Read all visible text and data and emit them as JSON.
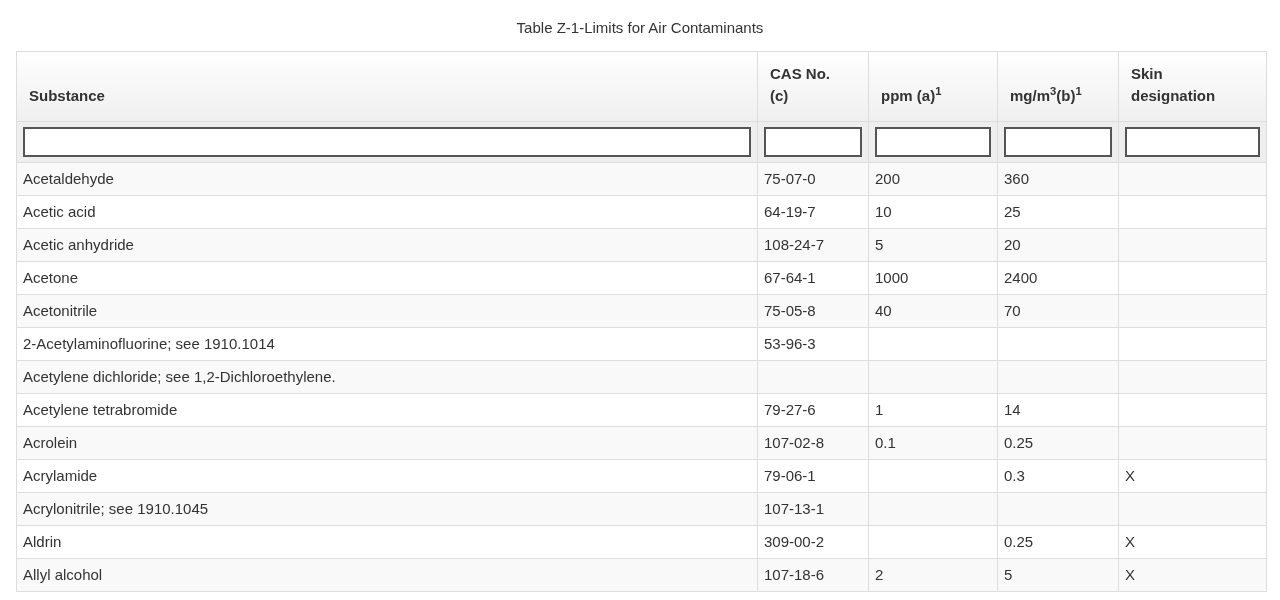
{
  "title": "Table Z-1-Limits for Air Contaminants",
  "table": {
    "columns": [
      {
        "label": "Substance"
      },
      {
        "label": "CAS No. (c)"
      },
      {
        "label": "ppm (a)$^{1}$"
      },
      {
        "label": "mg/m$^{3}$(b)$^{1}$"
      },
      {
        "label": "Skin designation"
      }
    ],
    "rows": [
      {
        "substance": "Acetaldehyde",
        "cas": "75-07-0",
        "ppm": "200",
        "mg": "360"
      },
      {
        "substance": "Acetic acid",
        "cas": "64-19-7",
        "ppm": "10",
        "mg": "25"
      },
      {
        "substance": "Acetic anhydride",
        "cas": "108-24-7",
        "ppm": "5",
        "mg": "20"
      },
      {
        "substance": "Acetone",
        "cas": "67-64-1",
        "ppm": "1000",
        "mg": "2400"
      },
      {
        "substance": "Acetonitrile",
        "cas": "75-05-8",
        "ppm": "40",
        "mg": "70"
      },
      {
        "substance": "2-Acetylaminofluorine; see 1910.1014",
        "cas": "53-96-3"
      },
      {
        "substance": "Acetylene dichloride; see 1,2-Dichloroethylene."
      },
      {
        "substance": "Acetylene tetrabromide",
        "cas": "79-27-6",
        "ppm": "1",
        "mg": "14"
      },
      {
        "substance": "Acrolein",
        "cas": "107-02-8",
        "ppm": "0.1",
        "mg": "0.25"
      },
      {
        "substance": "Acrylamide",
        "cas": "79-06-1",
        "mg": "0.3",
        "skin": "X"
      },
      {
        "substance": "Acrylonitrile; see 1910.1045",
        "cas": "107-13-1"
      },
      {
        "substance": "Aldrin",
        "cas": "309-00-2",
        "mg": "0.25",
        "skin": "X"
      },
      {
        "substance": "Allyl alcohol",
        "cas": "107-18-6",
        "ppm": "2",
        "mg": "5",
        "skin": "X"
      }
    ]
  }
}
